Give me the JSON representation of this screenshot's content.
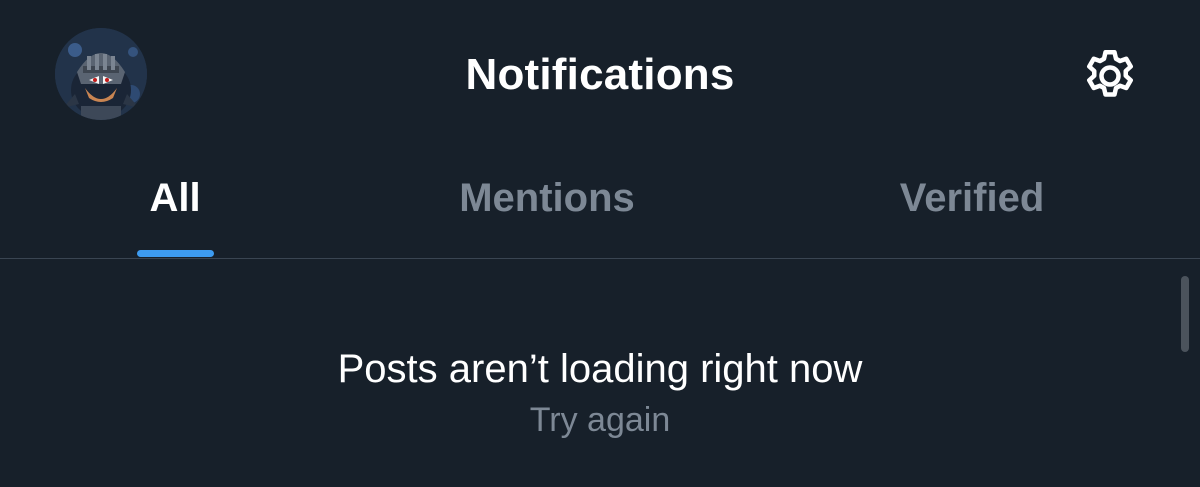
{
  "header": {
    "title": "Notifications",
    "avatar_icon": "user-avatar",
    "settings_icon": "gear-icon"
  },
  "tabs": [
    {
      "label": "All",
      "active": true
    },
    {
      "label": "Mentions",
      "active": false
    },
    {
      "label": "Verified",
      "active": false
    }
  ],
  "feed": {
    "error_message": "Posts aren’t loading right now",
    "retry_label": "Try again"
  },
  "colors": {
    "background": "#17202a",
    "accent": "#3d9bf0",
    "muted_text": "#7d8895",
    "divider": "#3a4552"
  }
}
